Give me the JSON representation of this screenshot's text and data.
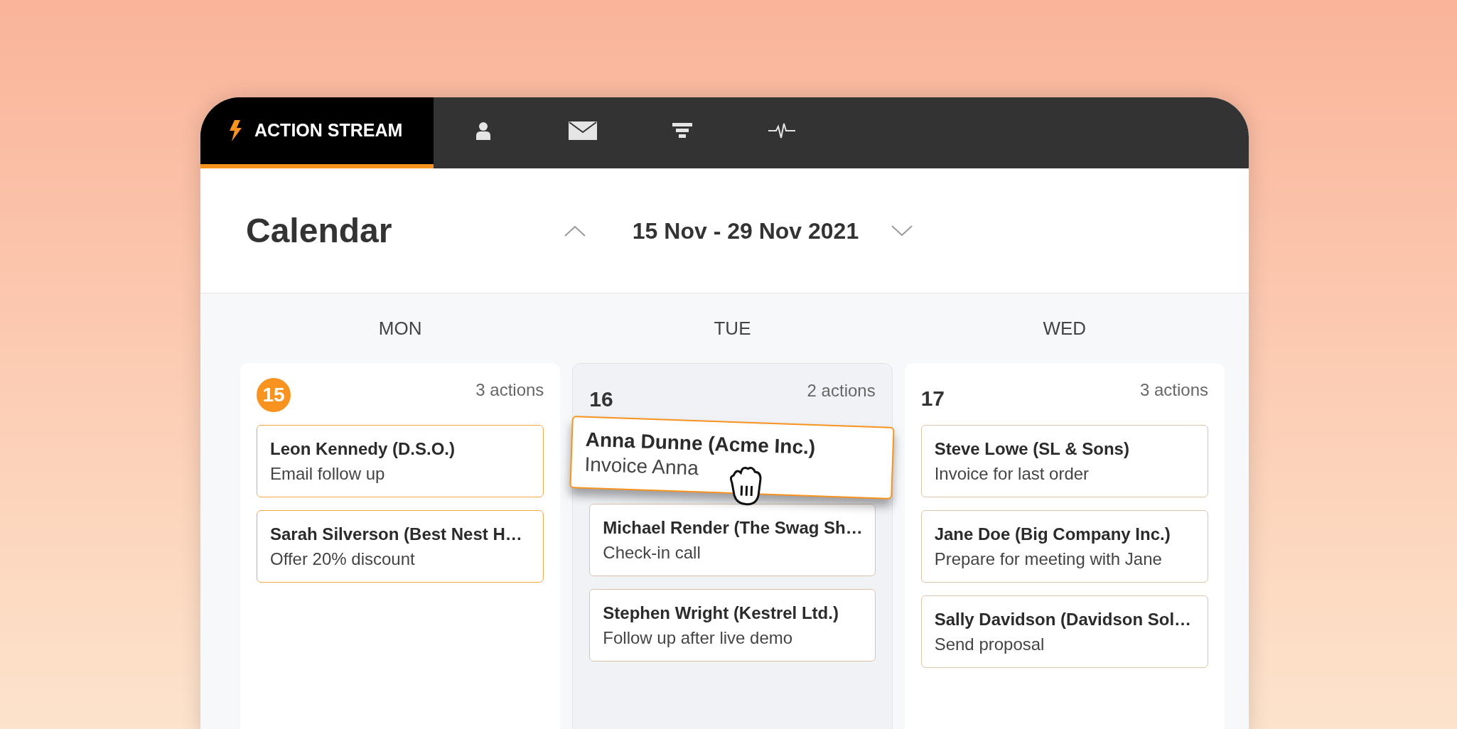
{
  "tabs": [
    {
      "kind": "stream",
      "label": "ACTION STREAM",
      "selected": true
    },
    {
      "kind": "person",
      "selected": false
    },
    {
      "kind": "mail",
      "selected": false
    },
    {
      "kind": "funnel",
      "selected": false
    },
    {
      "kind": "pulse",
      "selected": false
    }
  ],
  "calendar": {
    "title": "Calendar",
    "range": "15 Nov - 29 Nov 2021"
  },
  "days": [
    {
      "weekday": "MON",
      "date": "15",
      "today": true,
      "drop_target": false,
      "count": "3 actions",
      "cards": [
        {
          "title": "Leon Kennedy (D.S.O.)",
          "subtitle": "Email follow up",
          "dragging": false
        },
        {
          "title": "Sarah Silverson (Best Nest H…",
          "subtitle": "Offer 20% discount",
          "dragging": false
        }
      ]
    },
    {
      "weekday": "TUE",
      "date": "16",
      "today": false,
      "drop_target": true,
      "count": "2 actions",
      "cards": [
        {
          "title": "Anna Dunne (Acme Inc.)",
          "subtitle": "Invoice Anna",
          "dragging": true
        },
        {
          "title": "Michael Render (The Swag Sh…",
          "subtitle": "Check-in call",
          "dragging": false
        },
        {
          "title": "Stephen Wright (Kestrel Ltd.)",
          "subtitle": "Follow up after live demo",
          "dragging": false
        }
      ]
    },
    {
      "weekday": "WED",
      "date": "17",
      "today": false,
      "drop_target": false,
      "count": "3 actions",
      "cards": [
        {
          "title": "Steve Lowe (SL & Sons)",
          "subtitle": "Invoice for last order",
          "dragging": false
        },
        {
          "title": "Jane Doe (Big Company Inc.)",
          "subtitle": "Prepare for meeting with Jane",
          "dragging": false
        },
        {
          "title": "Sally Davidson (Davidson Sol…",
          "subtitle": "Send proposal",
          "dragging": false
        }
      ]
    }
  ]
}
